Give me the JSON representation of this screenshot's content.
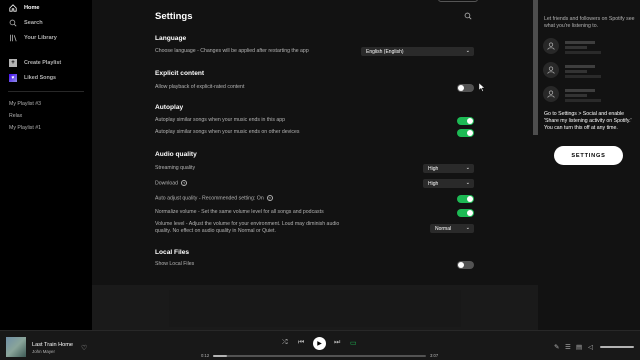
{
  "sidebar": {
    "nav": [
      {
        "label": "Home",
        "icon": "home-icon"
      },
      {
        "label": "Search",
        "icon": "search-icon"
      },
      {
        "label": "Your Library",
        "icon": "library-icon"
      }
    ],
    "create_playlist": "Create Playlist",
    "liked_songs": "Liked Songs",
    "playlists": [
      "My Playlist #3",
      "Relax",
      "My Playlist #1"
    ]
  },
  "settings": {
    "title": "Settings",
    "language": {
      "heading": "Language",
      "label": "Choose language - Changes will be applied after restarting the app",
      "value": "English (English)"
    },
    "explicit": {
      "heading": "Explicit content",
      "label": "Allow playback of explicit-rated content",
      "on": false
    },
    "autoplay": {
      "heading": "Autoplay",
      "rows": [
        {
          "label": "Autoplay similar songs when your music ends in this app",
          "on": true
        },
        {
          "label": "Autoplay similar songs when your music ends on other devices",
          "on": true
        }
      ]
    },
    "audio": {
      "heading": "Audio quality",
      "streaming_label": "Streaming quality",
      "streaming_value": "High",
      "download_label": "Download",
      "download_value": "High",
      "auto_adjust_label": "Auto adjust quality - Recommended setting: On",
      "auto_adjust_on": true,
      "normalize_label": "Normalize volume - Set the same volume level for all songs and podcasts",
      "normalize_on": true,
      "volume_label_1": "Volume level - Adjust the volume for your environment. Loud may diminish audio",
      "volume_label_2": "quality. No effect on audio quality in Normal or Quiet.",
      "volume_value": "Normal"
    },
    "local_files": {
      "heading": "Local Files",
      "label": "Show Local Files",
      "on": false
    }
  },
  "friends": {
    "intro": "Let friends and followers on Spotify see what you're listening to.",
    "info": "Go to Settings > Social and enable 'Share my listening activity on Spotify.' You can turn this off at any time.",
    "button": "SETTINGS"
  },
  "player": {
    "track": "Last Train Home",
    "artist": "John Mayer",
    "elapsed": "0:12",
    "duration": "3:07",
    "progress_fraction": 0.064,
    "accent": "#1db954"
  }
}
